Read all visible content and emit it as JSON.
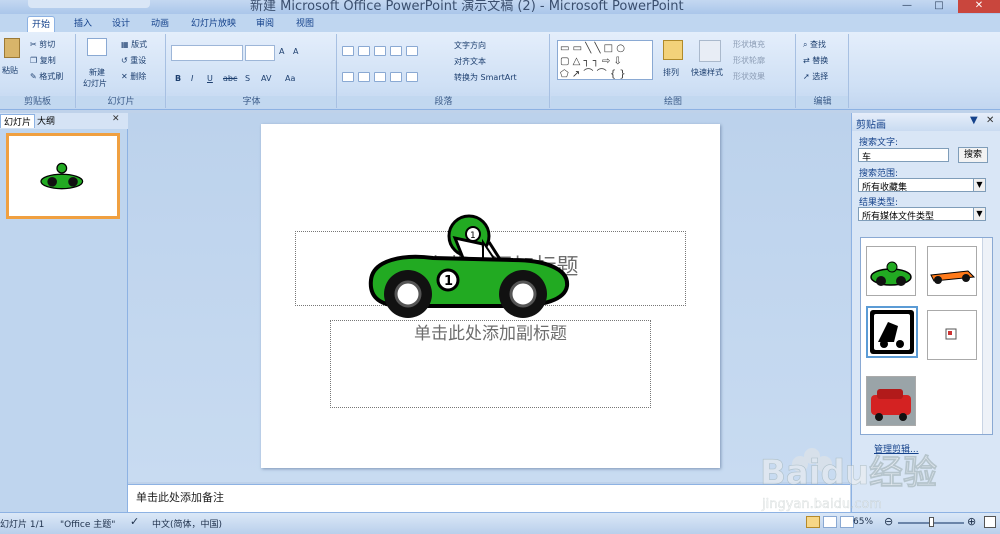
{
  "window": {
    "title": "新建 Microsoft Office PowerPoint 演示文稿 (2) - Microsoft PowerPoint",
    "minimize": "—",
    "maximize": "□",
    "close": "✕"
  },
  "ribbon_tabs": [
    "开始",
    "插入",
    "设计",
    "动画",
    "幻灯片放映",
    "审阅",
    "视图"
  ],
  "clipboard": {
    "paste": "粘贴",
    "cut": "剪切",
    "copy": "复制",
    "format_painter": "格式刷",
    "label": "剪贴板"
  },
  "slides_group": {
    "new_slide": "新建",
    "new_slide2": "幻灯片",
    "layout": "版式",
    "reset": "重设",
    "delete": "删除",
    "label": "幻灯片"
  },
  "font_group": {
    "label": "字体",
    "bold": "B",
    "italic": "I",
    "underline": "U",
    "strike": "abc",
    "shadow": "S",
    "spacing": "AV",
    "case": "Aa",
    "grow": "A",
    "shrink": "A"
  },
  "paragraph_group": {
    "text_direction": "文字方向",
    "align_text": "对齐文本",
    "smartart": "转换为 SmartArt",
    "label": "段落"
  },
  "drawing_group": {
    "arrange": "排列",
    "quick_styles": "快速样式",
    "shape_fill": "形状填充",
    "shape_outline": "形状轮廓",
    "shape_effects": "形状效果",
    "label": "绘图"
  },
  "editing_group": {
    "find": "查找",
    "replace": "替换",
    "select": "选择",
    "label": "编辑"
  },
  "left_pane": {
    "tab_slides": "幻灯片",
    "tab_outline": "大纲",
    "close": "✕",
    "slide_number": "1"
  },
  "slide": {
    "title_placeholder": "单击此处添加标题",
    "subtitle_placeholder": "单击此处添加副标题"
  },
  "notes_placeholder": "单击此处添加备注",
  "clip_art": {
    "header": "剪贴画",
    "search_label": "搜索文字:",
    "search_value": "车",
    "search_button": "搜索",
    "scope_label": "搜索范围:",
    "scope_value": "所有收藏集",
    "type_label": "结果类型:",
    "type_value": "所有媒体文件类型",
    "manage_link": "管理剪辑..."
  },
  "status_bar": {
    "slide_info": "幻灯片 1/1",
    "theme": "\"Office 主题\"",
    "language": "中文(简体，中国)",
    "zoom": "65%",
    "zoom_level": 0.65
  },
  "watermark": {
    "text": "Baidu经验",
    "sub": "jingyan.baidu.com"
  },
  "colors": {
    "ribbon": "#dbe7f7",
    "accent": "#15428b",
    "thumb_selected": "#f0a040",
    "close": "#c9463d"
  }
}
